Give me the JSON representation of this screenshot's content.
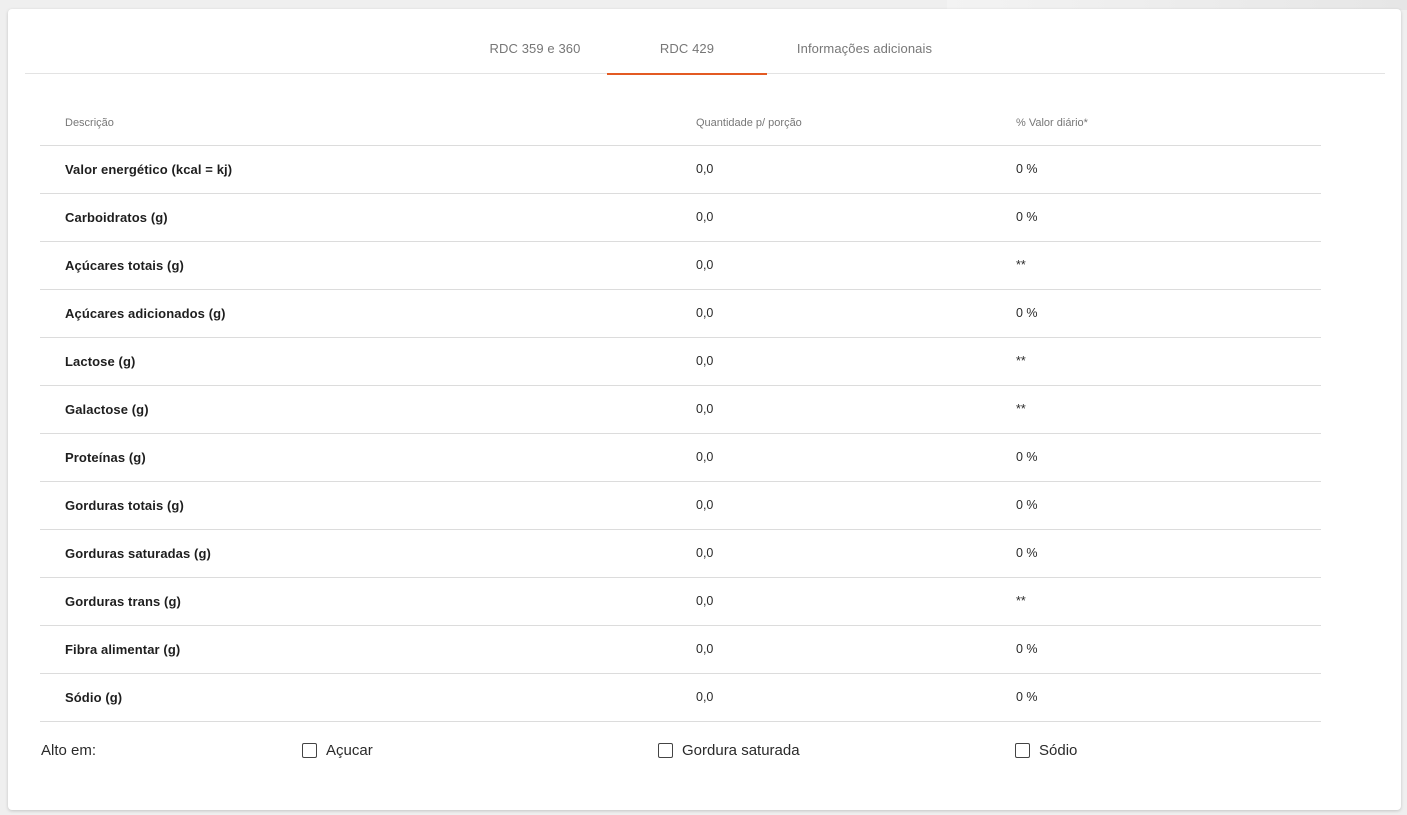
{
  "tabs": [
    {
      "label": "RDC 359 e 360"
    },
    {
      "label": "RDC 429"
    },
    {
      "label": "Informações adicionais"
    }
  ],
  "table": {
    "headers": {
      "description": "Descrição",
      "quantity": "Quantidade p/ porção",
      "daily_value": "% Valor diário*"
    },
    "rows": [
      {
        "description": "Valor energético (kcal = kj)",
        "quantity": "0,0",
        "daily_value": "0 %"
      },
      {
        "description": "Carboidratos (g)",
        "quantity": "0,0",
        "daily_value": "0 %"
      },
      {
        "description": "Açúcares totais (g)",
        "quantity": "0,0",
        "daily_value": "**"
      },
      {
        "description": "Açúcares adicionados (g)",
        "quantity": "0,0",
        "daily_value": "0 %"
      },
      {
        "description": "Lactose (g)",
        "quantity": "0,0",
        "daily_value": "**"
      },
      {
        "description": "Galactose (g)",
        "quantity": "0,0",
        "daily_value": "**"
      },
      {
        "description": "Proteínas (g)",
        "quantity": "0,0",
        "daily_value": "0 %"
      },
      {
        "description": "Gorduras totais (g)",
        "quantity": "0,0",
        "daily_value": "0 %"
      },
      {
        "description": "Gorduras saturadas (g)",
        "quantity": "0,0",
        "daily_value": "0 %"
      },
      {
        "description": "Gorduras trans (g)",
        "quantity": "0,0",
        "daily_value": "**"
      },
      {
        "description": "Fibra alimentar (g)",
        "quantity": "0,0",
        "daily_value": "0 %"
      },
      {
        "description": "Sódio (g)",
        "quantity": "0,0",
        "daily_value": "0 %"
      }
    ]
  },
  "high_in": {
    "label": "Alto em:",
    "options": [
      {
        "label": "Açucar",
        "checked": false
      },
      {
        "label": "Gordura saturada",
        "checked": false
      },
      {
        "label": "Sódio",
        "checked": false
      }
    ]
  }
}
